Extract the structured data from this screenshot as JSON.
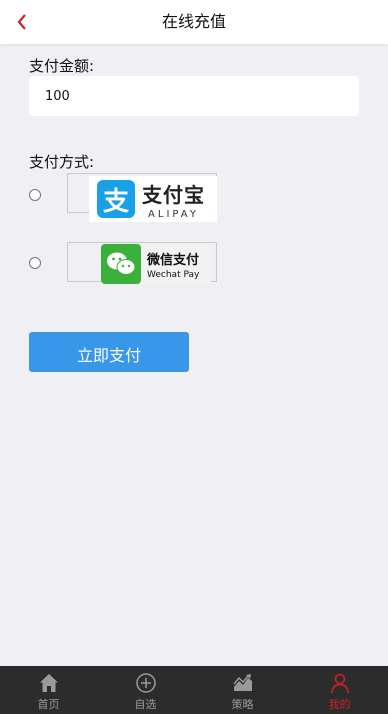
{
  "header": {
    "title": "在线充值"
  },
  "amount": {
    "label": "支付金额:",
    "value": "100"
  },
  "method": {
    "label": "支付方式:",
    "alipay": {
      "cn": "支付宝",
      "en": "ALIPAY"
    },
    "wechat": {
      "cn": "微信支付",
      "en": "Wechat Pay"
    }
  },
  "submit_label": "立即支付",
  "tabbar": {
    "items": [
      {
        "label": "首页",
        "icon": "home-icon"
      },
      {
        "label": "自选",
        "icon": "plus-circle-icon"
      },
      {
        "label": "策略",
        "icon": "chart-icon"
      },
      {
        "label": "我的",
        "icon": "user-icon"
      }
    ],
    "active": "我的"
  },
  "colors": {
    "accent_red": "#d0202a",
    "button_blue": "#3897e8",
    "alipay_blue": "#1aa0e8",
    "wechat_green": "#3bb03b",
    "tabbar_bg": "#2c2c2c"
  }
}
